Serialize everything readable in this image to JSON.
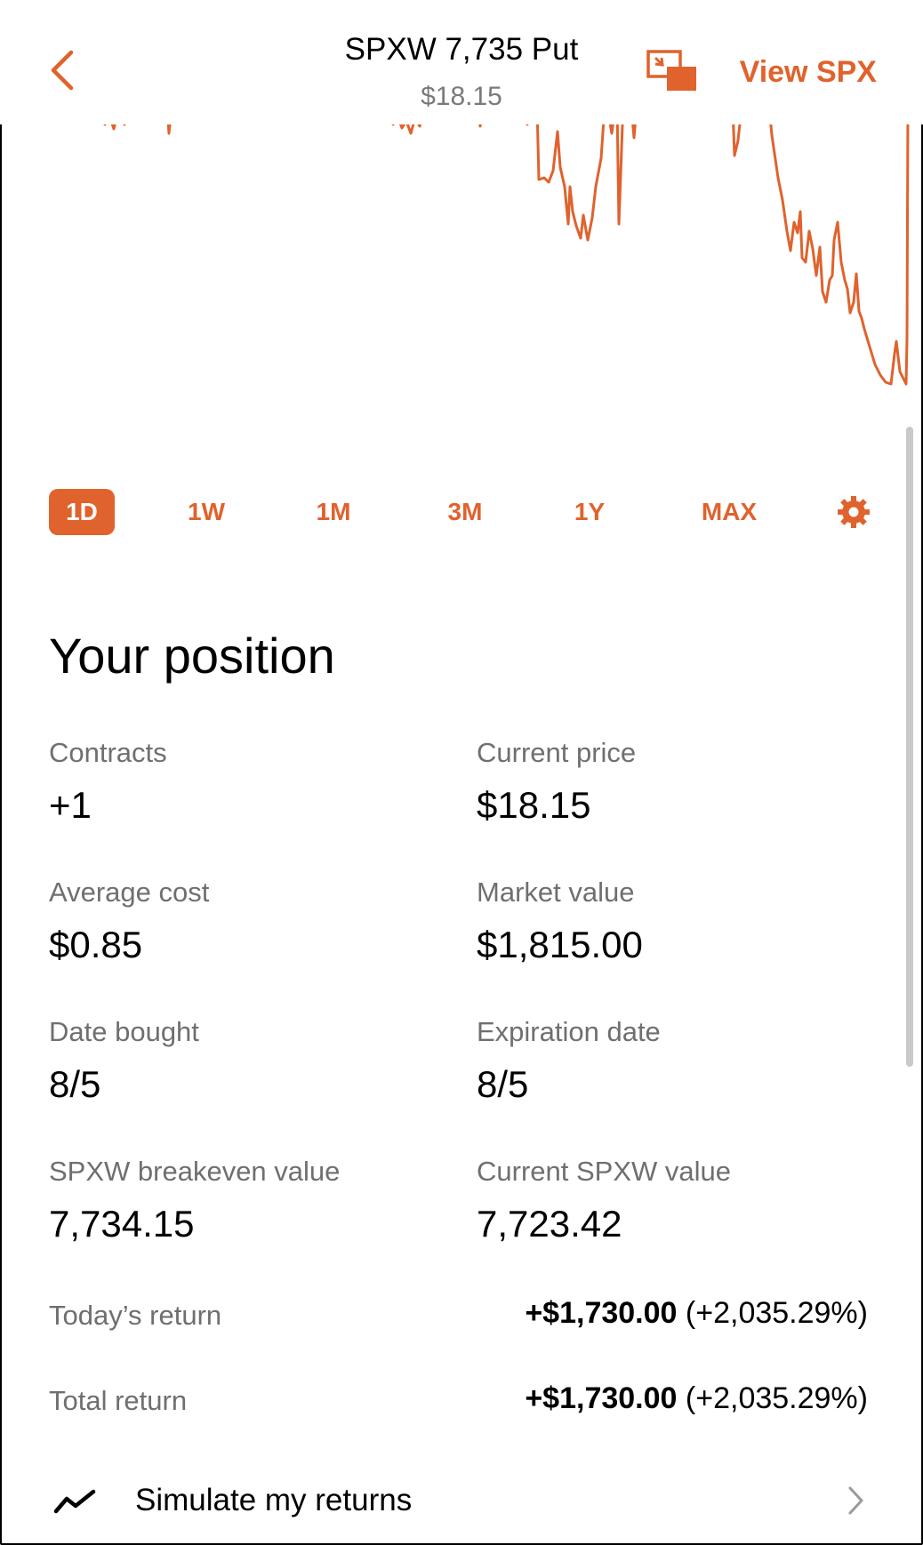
{
  "header": {
    "title": "SPXW 7,735 Put",
    "price": "$18.15",
    "view_link": "View SPX",
    "accent_color": "#e0622d",
    "back_icon": "chevron-left-icon",
    "pip_icon": "picture-in-picture-icon"
  },
  "ranges": [
    "1D",
    "1W",
    "1M",
    "3M",
    "1Y",
    "MAX"
  ],
  "selected_range": "1D",
  "settings_icon": "gear-icon",
  "position": {
    "heading": "Your position",
    "stats": [
      {
        "label": "Contracts",
        "value": "+1"
      },
      {
        "label": "Current price",
        "value": "$18.15"
      },
      {
        "label": "Average cost",
        "value": "$0.85"
      },
      {
        "label": "Market value",
        "value": "$1,815.00"
      },
      {
        "label": "Date bought",
        "value": "8/5"
      },
      {
        "label": "Expiration date",
        "value": "8/5"
      },
      {
        "label": "SPXW breakeven value",
        "value": "7,734.15"
      },
      {
        "label": "Current SPXW value",
        "value": "7,723.42"
      }
    ],
    "returns": [
      {
        "label": "Today’s return",
        "amount": "+$1,730.00",
        "percent": "(+2,035.29%)"
      },
      {
        "label": "Total return",
        "amount": "+$1,730.00",
        "percent": "(+2,035.29%)"
      }
    ]
  },
  "simulate": {
    "label": "Simulate my returns",
    "icon": "trend-line-icon",
    "chevron": "chevron-right-icon"
  }
}
